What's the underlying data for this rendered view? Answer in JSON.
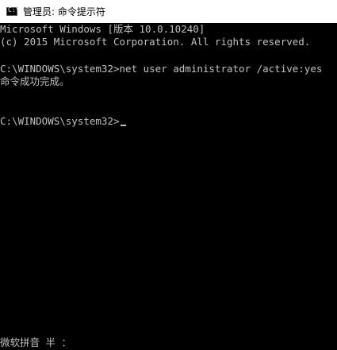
{
  "window": {
    "title": "管理员: 命令提示符",
    "icon": "console-icon",
    "icon_glyph": "C:\\"
  },
  "console": {
    "lines": [
      "Microsoft Windows [版本 10.0.10240]",
      "(c) 2015 Microsoft Corporation. All rights reserved.",
      "",
      "C:\\WINDOWS\\system32>net user administrator /active:yes",
      "命令成功完成。",
      "",
      "",
      "C:\\WINDOWS\\system32>"
    ]
  },
  "ime": {
    "status": "微软拼音 半 ："
  },
  "colors": {
    "background": "#000000",
    "text": "#c0c0c0",
    "titlebar": "#ffffff"
  }
}
